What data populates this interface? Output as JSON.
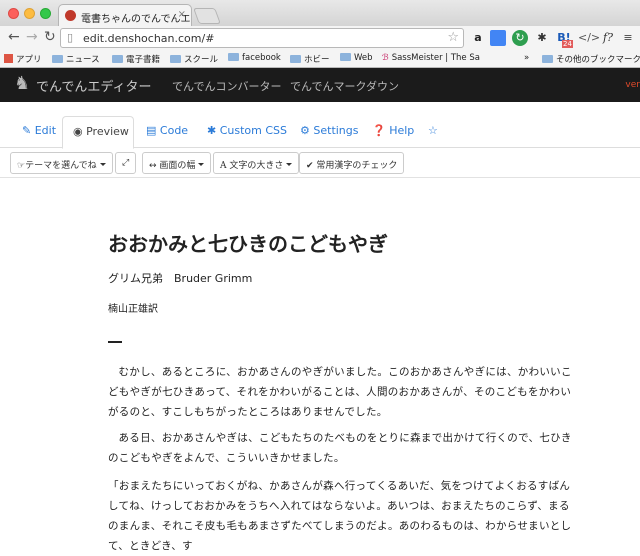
{
  "browser": {
    "tab_title": "電書ちゃんのでんでんエディ",
    "tab_close": "×",
    "url": "edit.denshochan.com/#",
    "bookmarks": [
      {
        "label": "アプリ",
        "type": "apps"
      },
      {
        "label": "ニュース",
        "type": "folder"
      },
      {
        "label": "電子書籍",
        "type": "folder"
      },
      {
        "label": "スクール",
        "type": "folder"
      },
      {
        "label": "facebook",
        "type": "folder"
      },
      {
        "label": "ホビー",
        "type": "folder"
      },
      {
        "label": "Web",
        "type": "folder"
      },
      {
        "label": "SassMeister | The Sa",
        "type": "page"
      }
    ],
    "bookmarks_more": "»",
    "other_bookmarks": "その他のブックマーク",
    "extension_badge": "24"
  },
  "header": {
    "brand": "でんでんエディター",
    "nav": [
      "でんでんコンバーター",
      "でんでんマークダウン"
    ],
    "version": "ver"
  },
  "tabs": [
    {
      "label": "Edit",
      "icon": "pencil-icon",
      "active": false
    },
    {
      "label": "Preview",
      "icon": "eye-icon",
      "active": true
    },
    {
      "label": "Code",
      "icon": "code-icon",
      "active": false
    },
    {
      "label": "Custom CSS",
      "icon": "asterisk-icon",
      "active": false
    },
    {
      "label": "Settings",
      "icon": "gear-icon",
      "active": false
    },
    {
      "label": "Help",
      "icon": "help-icon",
      "active": false
    },
    {
      "label": "",
      "icon": "star-icon",
      "active": false
    }
  ],
  "toolbar": {
    "theme": "テーマを選んでね",
    "fullscreen": "⤢",
    "width": "画面の幅",
    "font_size": "文字の大きさ",
    "kanji_check": "常用漢字のチェック"
  },
  "document": {
    "title": "おおかみと七ひきのこどもやぎ",
    "author": "グリム兄弟　Bruder Grimm",
    "translator": "楠山正雄訳",
    "paragraphs": [
      "むかし、あるところに、おかあさんのやぎがいました。このおかあさんやぎには、かわいいこどもやぎが七ひきあって、それをかわいがることは、人間のおかあさんが、そのこどもをかわいがるのと、すこしもちがったところはありませんでした。",
      "ある日、おかあさんやぎは、こどもたちのたべものをとりに森まで出かけて行くので、七ひきのこどもやぎをよんで、こういいきかせました。",
      "「おまえたちにいっておくがね、かあさんが森へ行ってくるあいだ、気をつけてよくおるすばんしてね、けっしておおかみをうちへ入れてはならないよ。あいつは、おまえたちのこらず、まるのまんま、それこそ皮も毛もあまさずたべてしまうのだよ。あのわるものは、わからせまいとして、ときどき、す"
    ]
  }
}
